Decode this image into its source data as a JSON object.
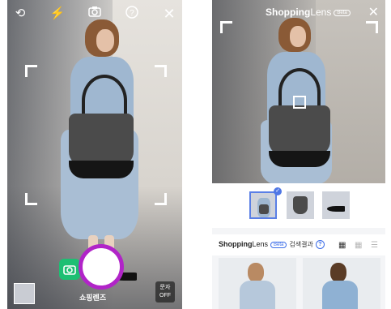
{
  "camera": {
    "icons": [
      "refresh-icon",
      "flash-icon",
      "camera-switch-icon",
      "help-icon",
      "close-icon"
    ],
    "shutter_label": "쇼핑렌즈",
    "text_toggle": {
      "line1": "문자",
      "line2": "OFF"
    },
    "mode_icon": "camera-mode-icon",
    "accent_purple": "#b124c8",
    "accent_green": "#1dbf73"
  },
  "lens": {
    "brand": "Shopping",
    "brand_suffix": "Lens",
    "beta": "Beta",
    "thumbnails": 3,
    "selected_thumbnail": 0,
    "results": {
      "brand": "Shopping",
      "brand_suffix": "Lens",
      "beta": "Beta",
      "title": "검색결과",
      "help": "?"
    },
    "accent_blue": "#4f77e5"
  }
}
